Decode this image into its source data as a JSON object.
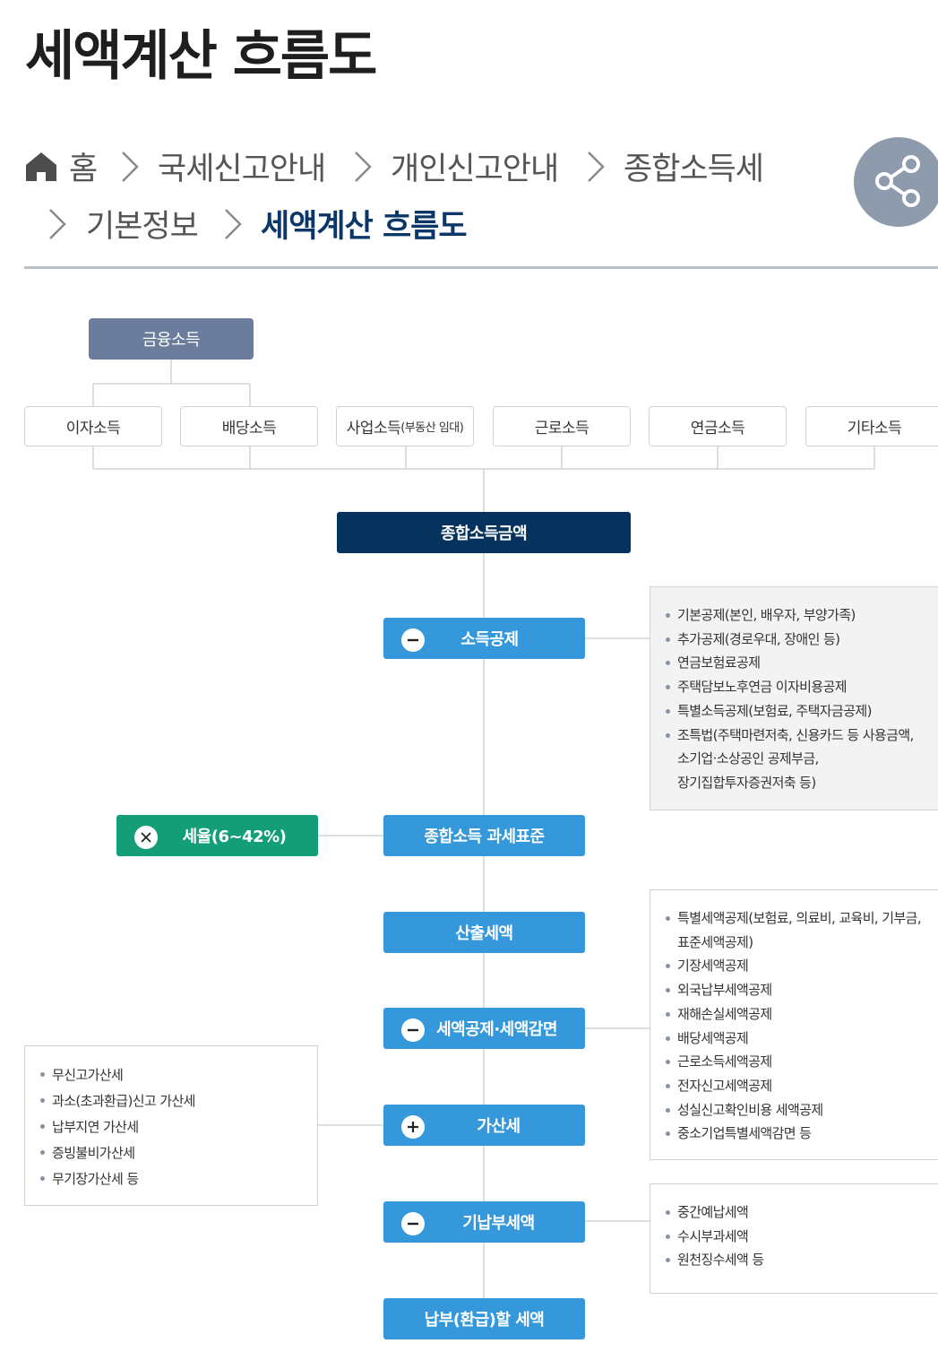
{
  "page": {
    "title": "세액계산 흐름도"
  },
  "breadcrumb": {
    "items": [
      "홈",
      "국세신고안내",
      "개인신고안내",
      "종합소득세",
      "기본정보",
      "세액계산 흐름도"
    ]
  },
  "icons": {
    "home": "home-icon",
    "share": "share-icon",
    "separator": "chevron-right-icon",
    "minus": "minus-circle-icon",
    "plus": "plus-circle-icon",
    "times": "times-circle-icon"
  },
  "colors": {
    "primary_dark": "#05335e",
    "step_blue": "#3498db",
    "rate_green": "#139e77",
    "top_node": "#6b7c9c",
    "share_bg": "#8e9bac"
  },
  "diagram": {
    "top_node": "금융소득",
    "income_sources": [
      {
        "main": "이자소득",
        "sub": ""
      },
      {
        "main": "배당소득",
        "sub": ""
      },
      {
        "main": "사업소득",
        "sub": "(부동산 임대)"
      },
      {
        "main": "근로소득",
        "sub": ""
      },
      {
        "main": "연금소득",
        "sub": ""
      },
      {
        "main": "기타소득",
        "sub": ""
      }
    ],
    "total_income": "종합소득금액",
    "steps": {
      "income_deduction": {
        "label": "소득공제",
        "op": "minus"
      },
      "tax_base": {
        "label": "종합소득 과세표준"
      },
      "tax_rate": {
        "label": "세율(6~42%)",
        "op": "times"
      },
      "calculated_tax": {
        "label": "산출세액"
      },
      "tax_credit": {
        "label": "세액공제·세액감면",
        "op": "minus"
      },
      "additional_tax": {
        "label": "가산세",
        "op": "plus"
      },
      "prepaid_tax": {
        "label": "기납부세액",
        "op": "minus"
      },
      "final_tax": {
        "label": "납부(환급)할 세액"
      }
    },
    "income_deduction_items": [
      {
        "text": "기본공제(본인, 배우자, 부양가족)",
        "cont": false
      },
      {
        "text": "추가공제(경로우대, 장애인 등)",
        "cont": false
      },
      {
        "text": "연금보험료공제",
        "cont": false
      },
      {
        "text": "주택담보노후연금 이자비용공제",
        "cont": false
      },
      {
        "text": "특별소득공제(보험료, 주택자금공제)",
        "cont": false
      },
      {
        "text": "조특법(주택마련저축, 신용카드 등 사용금액,",
        "cont": false
      },
      {
        "text": "소기업·소상공인 공제부금,",
        "cont": true
      },
      {
        "text": "장기집합투자증권저축 등)",
        "cont": true
      }
    ],
    "tax_credit_items": [
      {
        "text": "특별세액공제(보험료, 의료비, 교육비, 기부금,",
        "cont": false
      },
      {
        "text": "표준세액공제)",
        "cont": true
      },
      {
        "text": "기장세액공제",
        "cont": false
      },
      {
        "text": "외국납부세액공제",
        "cont": false
      },
      {
        "text": "재해손실세액공제",
        "cont": false
      },
      {
        "text": "배당세액공제",
        "cont": false
      },
      {
        "text": "근로소득세액공제",
        "cont": false
      },
      {
        "text": "전자신고세액공제",
        "cont": false
      },
      {
        "text": "성실신고확인비용 세액공제",
        "cont": false
      },
      {
        "text": "중소기업특별세액감면 등",
        "cont": false
      }
    ],
    "additional_tax_items": [
      {
        "text": "무신고가산세",
        "cont": false
      },
      {
        "text": "과소(초과환급)신고 가산세",
        "cont": false
      },
      {
        "text": "납부지연 가산세",
        "cont": false
      },
      {
        "text": "증빙불비가산세",
        "cont": false
      },
      {
        "text": "무기장가산세 등",
        "cont": false
      }
    ],
    "prepaid_tax_items": [
      {
        "text": "중간예납세액",
        "cont": false
      },
      {
        "text": "수시부과세액",
        "cont": false
      },
      {
        "text": "원천징수세액 등",
        "cont": false
      }
    ]
  }
}
